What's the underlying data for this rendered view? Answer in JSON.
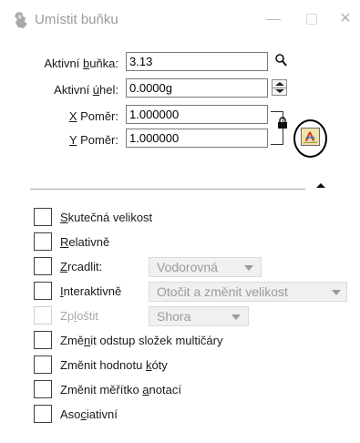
{
  "window": {
    "title": "Umístit buňku",
    "close_glyph": "✕"
  },
  "fields": {
    "active_cell_label_pre": "Aktivní ",
    "active_cell_label_u": "b",
    "active_cell_label_post": "uňka:",
    "active_cell_value": "3.13",
    "active_angle_label_pre": "Aktivní ",
    "active_angle_label_u": "ú",
    "active_angle_label_post": "hel:",
    "active_angle_value": "0.0000g",
    "x_scale_label_u": "X",
    "x_scale_label_post": " Poměr:",
    "x_scale_value": "1.000000",
    "y_scale_label_u": "Y",
    "y_scale_label_post": " Poměr:",
    "y_scale_value": "1.000000"
  },
  "options": {
    "true_scale": {
      "u": "S",
      "rest": "kutečná velikost"
    },
    "relative": {
      "u": "R",
      "rest": "elativně"
    },
    "mirror": {
      "u": "Z",
      "rest": "rcadlit:",
      "dropdown": "Vodorovná"
    },
    "interactive": {
      "u": "I",
      "rest": "nteraktivně",
      "dropdown": "Otočit a změnit velikost"
    },
    "flatten": {
      "pre": "Zp",
      "u": "l",
      "rest": "oštit",
      "dropdown": "Shora"
    },
    "mline_offset": {
      "pre": "Změ",
      "u": "n",
      "rest": "it odstup složek multičáry"
    },
    "dim_value": {
      "pre": "Změnit hodnotu ",
      "u": "k",
      "rest": "óty"
    },
    "anno_scale": {
      "pre": "Změnit měřítko ",
      "u": "a",
      "rest": "notací"
    },
    "associative": {
      "pre": "Aso",
      "u": "c",
      "rest": "iativní"
    }
  }
}
